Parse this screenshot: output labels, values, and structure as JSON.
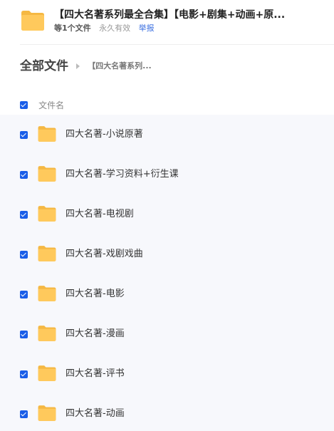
{
  "share": {
    "title": "【四大名著系列最全合集】【电影+剧集+动画+原...",
    "count_text": "等1个文件",
    "validity_text": "永久有效",
    "report_label": "举报"
  },
  "breadcrumb": {
    "root": "全部文件",
    "current": "【四大名著系列..."
  },
  "list_header": {
    "column_label": "文件名"
  },
  "files": [
    {
      "name": "四大名著-小说原著"
    },
    {
      "name": "四大名著-学习资料+衍生课"
    },
    {
      "name": "四大名著-电视剧"
    },
    {
      "name": "四大名著-戏剧戏曲"
    },
    {
      "name": "四大名著-电影"
    },
    {
      "name": "四大名著-漫画"
    },
    {
      "name": "四大名著-评书"
    },
    {
      "name": "四大名著-动画"
    }
  ],
  "colors": {
    "accent": "#1a5ee8",
    "folder": "#ffc95c",
    "folder_tab": "#f5b843",
    "list_bg": "#f7f8fc"
  }
}
